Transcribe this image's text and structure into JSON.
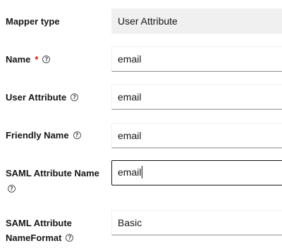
{
  "mapper_type": {
    "label": "Mapper type",
    "value": "User Attribute"
  },
  "name": {
    "label": "Name",
    "required_mark": "*",
    "value": "email"
  },
  "user_attribute": {
    "label": "User Attribute",
    "value": "email"
  },
  "friendly_name": {
    "label": "Friendly Name",
    "value": "email"
  },
  "saml_attribute_name": {
    "label": "SAML Attribute Name",
    "value": "email"
  },
  "saml_attribute_nameformat": {
    "label_line1": "SAML Attribute",
    "label_line2": "NameFormat",
    "value": "Basic"
  },
  "icons": {
    "help": "help-circle-icon",
    "help_glyph": "?"
  },
  "colors": {
    "required": "#c9190b",
    "readonly_bg": "#f0f0f0",
    "text": "#151515"
  }
}
